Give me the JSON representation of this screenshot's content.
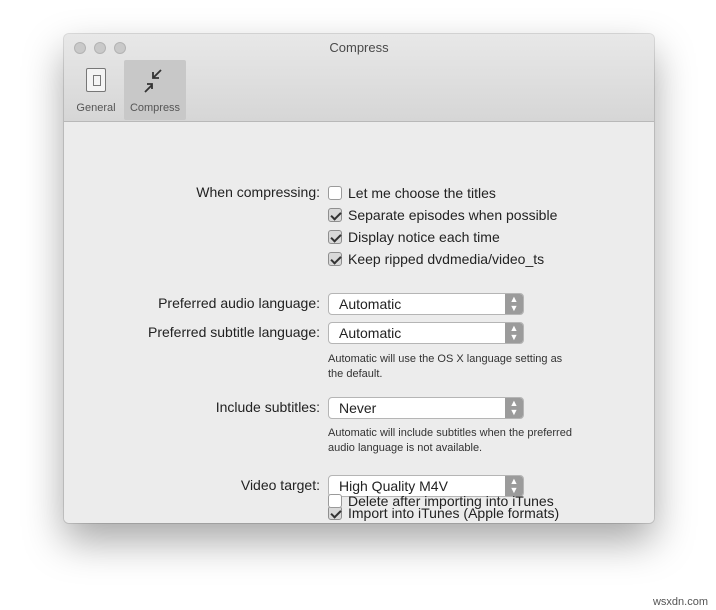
{
  "window": {
    "title": "Compress"
  },
  "toolbar": {
    "tabs": [
      {
        "label": "General",
        "icon": "document-icon"
      },
      {
        "label": "Compress",
        "icon": "compress-arrows-icon",
        "selected": true
      }
    ]
  },
  "compressing": {
    "label": "When compressing:",
    "options": [
      {
        "label": "Let me choose the titles",
        "checked": false
      },
      {
        "label": "Separate episodes when possible",
        "checked": true
      },
      {
        "label": "Display notice each time",
        "checked": true
      },
      {
        "label": "Keep ripped dvdmedia/video_ts",
        "checked": true
      }
    ]
  },
  "audio_language": {
    "label": "Preferred audio language:",
    "value": "Automatic"
  },
  "subtitle_language": {
    "label": "Preferred subtitle language:",
    "value": "Automatic",
    "note_line1": "Automatic will use the OS X language setting as",
    "note_line2": "the default."
  },
  "include_subtitles": {
    "label": "Include subtitles:",
    "value": "Never",
    "note_line1": "Automatic will include subtitles when the preferred",
    "note_line2": "audio language is not available."
  },
  "video_target": {
    "label": "Video target:",
    "value": "High Quality M4V",
    "options": [
      {
        "label": "Import into iTunes (Apple formats)",
        "checked": true
      },
      {
        "label": "Delete after importing into iTunes",
        "checked": false
      }
    ]
  },
  "watermark": "wsxdn.com"
}
